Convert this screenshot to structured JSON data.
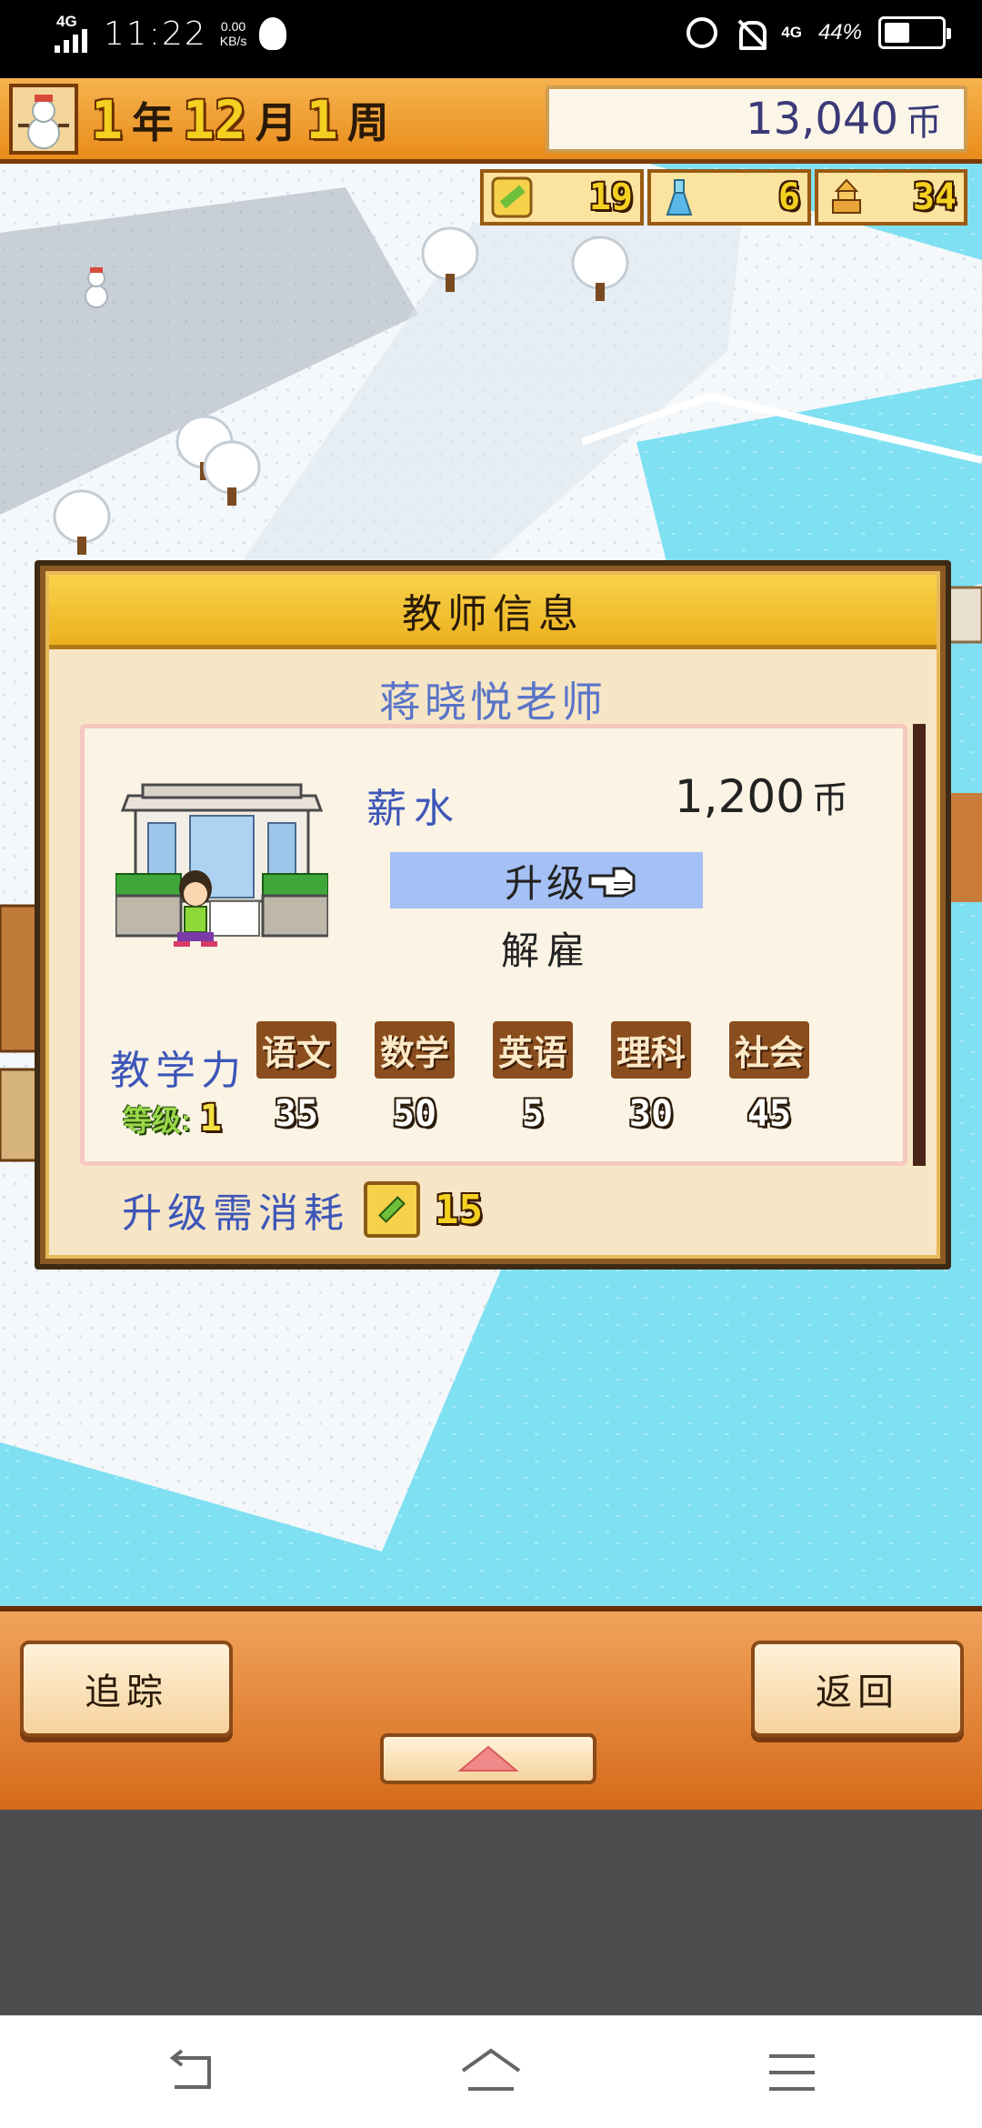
{
  "status_bar": {
    "network_left": "4G",
    "time": "11:22",
    "speed_value": "0.00",
    "speed_unit": "KB/s",
    "network_right": "4G",
    "battery_percent": "44%",
    "battery_level": 0.44,
    "icons": [
      "signal-icon",
      "qq-icon",
      "alarm-icon",
      "mute-icon",
      "battery-icon"
    ]
  },
  "hud_top": {
    "year_num": "1",
    "year_unit": "年",
    "month_num": "12",
    "month_unit": "月",
    "week_num": "1",
    "week_unit": "周",
    "money_value": "13,040",
    "money_unit": "币",
    "resources": [
      {
        "icon": "pencil-icon",
        "value": "19"
      },
      {
        "icon": "flask-icon",
        "value": "6"
      },
      {
        "icon": "pagoda-icon",
        "value": "34"
      }
    ]
  },
  "dialog": {
    "title": "教师信息",
    "teacher_name": "蒋晓悦老师",
    "salary_label": "薪水",
    "salary_value": "1,200",
    "salary_unit": "币",
    "upgrade_label": "升级",
    "dismiss_label": "解雇",
    "teaching_power_label": "教学力",
    "level_label": "等级:",
    "level_value": "1",
    "subjects": [
      {
        "name": "语文",
        "value": "35"
      },
      {
        "name": "数学",
        "value": "50"
      },
      {
        "name": "英语",
        "value": "5"
      },
      {
        "name": "理科",
        "value": "30"
      },
      {
        "name": "社会",
        "value": "45"
      }
    ],
    "cost_label": "升级需消耗",
    "cost_value": "15"
  },
  "hud_bottom": {
    "track_label": "追踪",
    "back_label": "返回"
  },
  "colors": {
    "hud_orange": "#e98c1b",
    "dialog_header": "#f9d24a",
    "label_blue": "#3d56b8",
    "highlight": "#a5c0f5",
    "water": "#66d8ee"
  }
}
